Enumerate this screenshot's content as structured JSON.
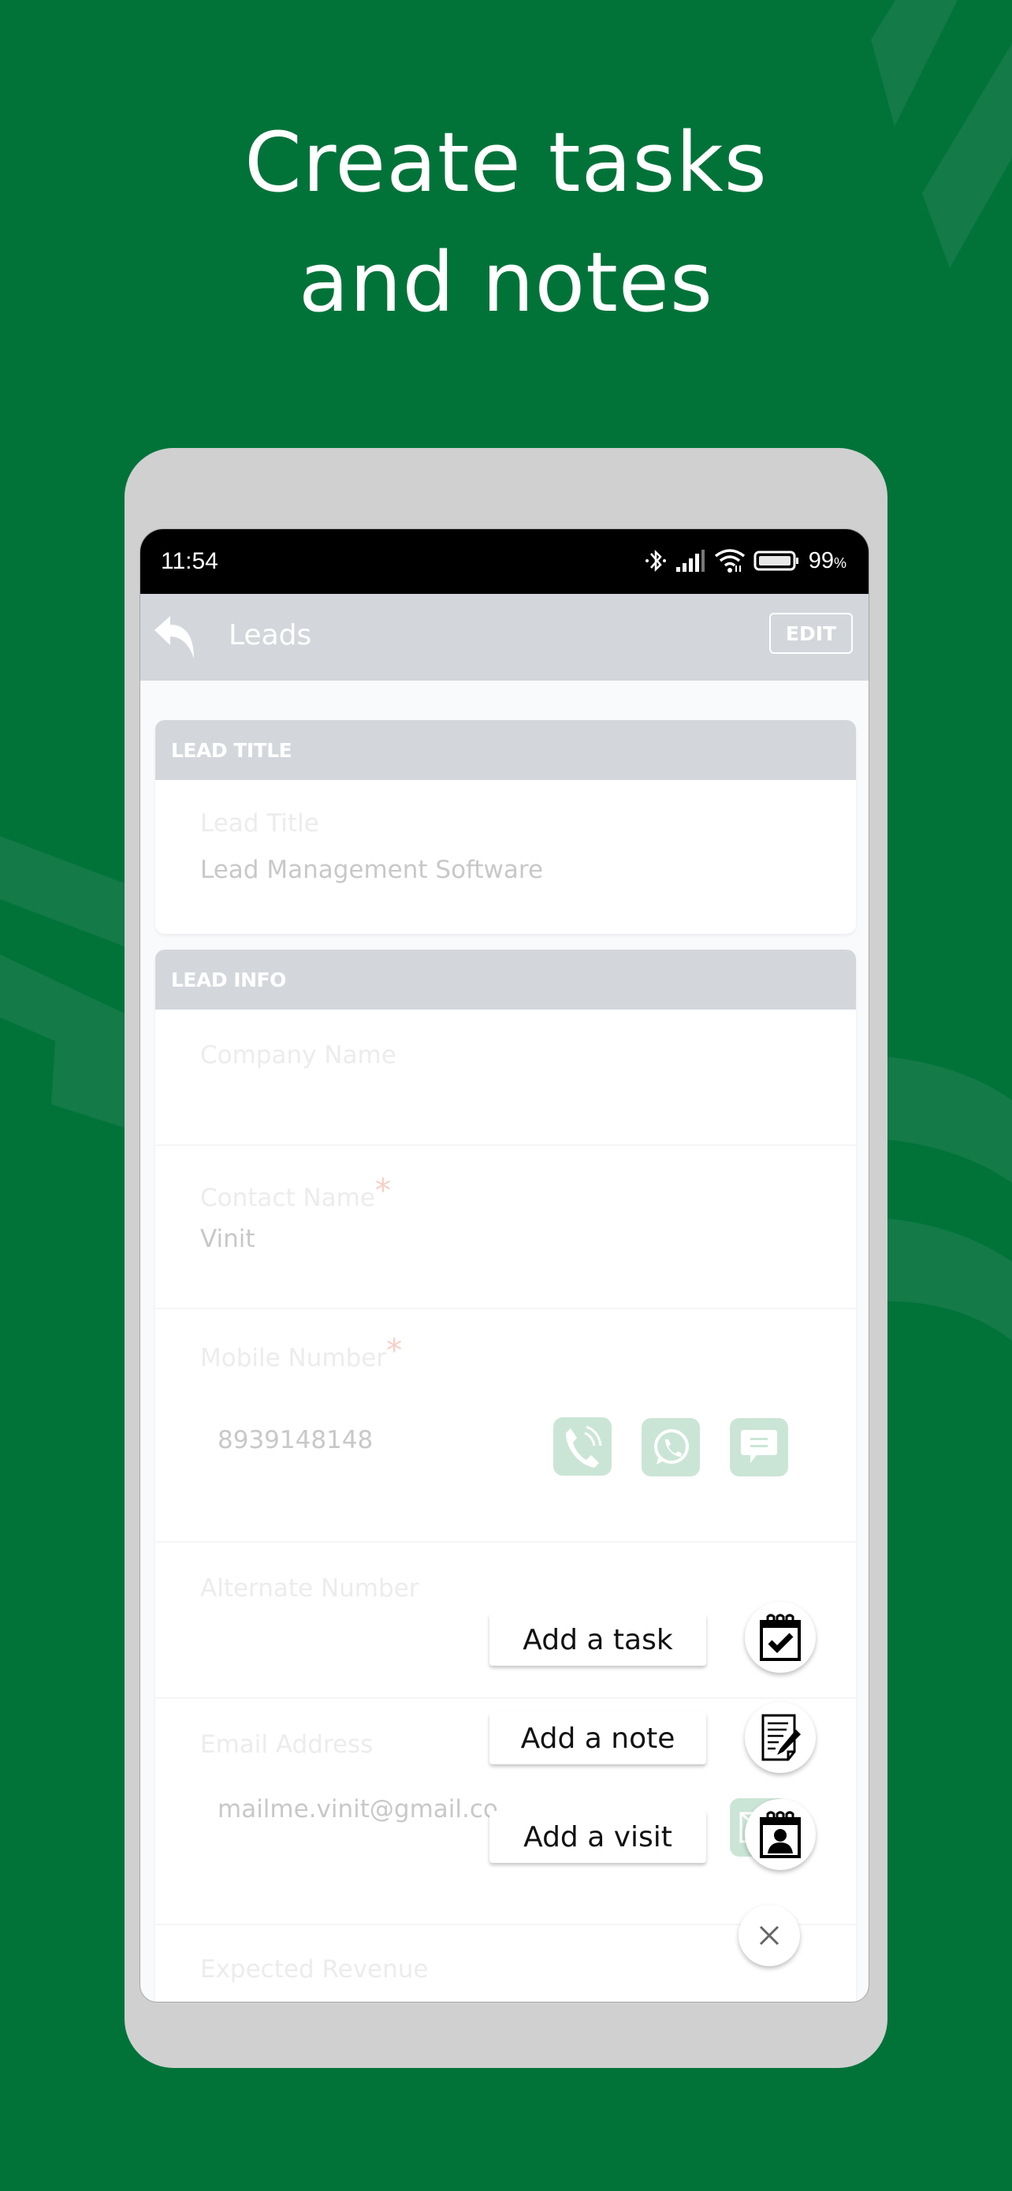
{
  "headline": {
    "line1": "Create tasks",
    "line2": "and notes"
  },
  "colors": {
    "background": "#017339",
    "accent_light": "#cae5d6",
    "header_gray": "#d3d7dc",
    "required": "#f7cfc6"
  },
  "status_bar": {
    "time": "11:54",
    "icons": [
      "bluetooth-icon",
      "signal-icon",
      "wifi-icon",
      "battery-icon"
    ],
    "battery_percent": "99",
    "percent_sign": "%"
  },
  "app_bar": {
    "back_icon": "back-arrow-icon",
    "title": "Leads",
    "edit_label": "EDIT"
  },
  "lead_title_card": {
    "header": "LEAD TITLE",
    "field_label": "Lead Title",
    "field_value": "Lead Management Software"
  },
  "lead_info_card": {
    "header": "LEAD INFO",
    "fields": [
      {
        "label": "Company Name",
        "value": "",
        "required": false
      },
      {
        "label": "Contact Name",
        "value": "Vinit",
        "required": true
      },
      {
        "label": "Mobile Number",
        "value": "8939148148",
        "required": true,
        "actions": [
          "phone-call-icon",
          "whatsapp-icon",
          "sms-icon"
        ]
      },
      {
        "label": "Alternate Number",
        "value": "",
        "required": false
      },
      {
        "label": "Email Address",
        "value": "mailme.vinit@gmail.co",
        "required": false,
        "actions": [
          "email-icon"
        ]
      },
      {
        "label": "Expected Revenue",
        "value": "",
        "required": false
      }
    ],
    "required_mark": "*"
  },
  "fab_menu": {
    "items": [
      {
        "label": "Add a task",
        "icon": "calendar-check-icon"
      },
      {
        "label": "Add a note",
        "icon": "note-edit-icon"
      },
      {
        "label": "Add a visit",
        "icon": "calendar-person-icon"
      }
    ],
    "close_icon": "close-icon"
  }
}
